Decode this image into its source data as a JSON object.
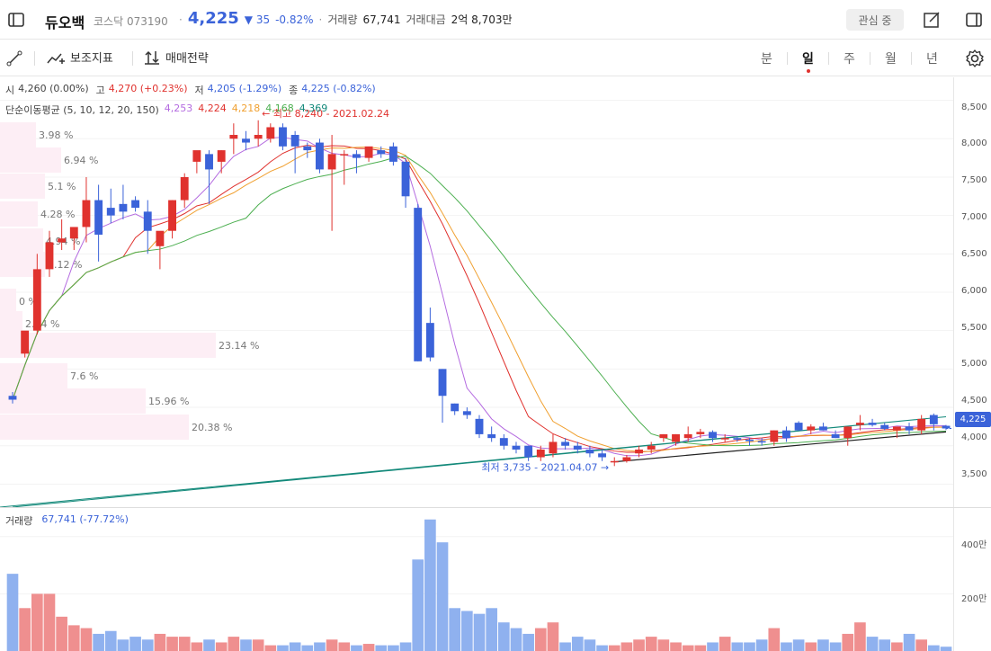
{
  "header": {
    "name": "듀오백",
    "market": "코스닥",
    "code": "073190",
    "price": "4,225",
    "change": "35",
    "change_pct": "-0.82%",
    "volume_label": "거래량",
    "volume": "67,741",
    "amount_label": "거래대금",
    "amount": "2억 8,703만",
    "watch_label": "관심 중"
  },
  "toolbar": {
    "indicator_label": "보조지표",
    "strategy_label": "매매전략",
    "periods": [
      "분",
      "일",
      "주",
      "월",
      "년"
    ],
    "active_period": "일"
  },
  "ohlc": {
    "open_label": "시",
    "open": "4,260 (0.00%)",
    "high_label": "고",
    "high": "4,270 (+0.23%)",
    "low_label": "저",
    "low": "4,205 (-1.29%)",
    "close_label": "종",
    "close": "4,225 (-0.82%)"
  },
  "ma": {
    "label": "단순이동평균 (5, 10, 12, 20, 150)",
    "values": [
      "4,253",
      "4,224",
      "4,218",
      "4,168",
      "4,369"
    ],
    "colors": [
      "#b46be0",
      "#e0322e",
      "#f0a030",
      "#4caf50",
      "#13897a"
    ]
  },
  "annotations": {
    "high": "최고 8,240 - 2021.02.24",
    "low": "최저 3,735 - 2021.04.07"
  },
  "volume_profile": [
    "3.98 %",
    "6.94 %",
    "5.1 %",
    "4.28 %",
    "4.94 %",
    "5.12 %",
    "0 %",
    "2.54 %",
    "23.14 %",
    "7.6 %",
    "15.96 %",
    "20.38 %"
  ],
  "y_axis": [
    "8,500",
    "8,000",
    "7,500",
    "7,000",
    "6,500",
    "6,000",
    "5,500",
    "5,000",
    "4,500",
    "4,000",
    "3,500"
  ],
  "current_price_tag": "4,225",
  "volume_panel": {
    "label": "거래량",
    "value": "67,741 (-77.72%)",
    "y_axis": [
      "400만",
      "200만"
    ]
  },
  "colors": {
    "up": "#e0322e",
    "down": "#3b63d9",
    "profile": "#fdeef5"
  },
  "chart_data": {
    "type": "candlestick",
    "ylim": [
      3200,
      8800
    ],
    "candles": [
      {
        "o": 4650,
        "h": 4700,
        "l": 4550,
        "c": 4600
      },
      {
        "o": 5200,
        "h": 5300,
        "l": 5150,
        "c": 5500
      },
      {
        "o": 5500,
        "h": 6500,
        "l": 5450,
        "c": 6300
      },
      {
        "o": 6300,
        "h": 6800,
        "l": 6200,
        "c": 6650
      },
      {
        "o": 6650,
        "h": 6950,
        "l": 6550,
        "c": 6700
      },
      {
        "o": 6700,
        "h": 6780,
        "l": 6550,
        "c": 6850
      },
      {
        "o": 6850,
        "h": 7500,
        "l": 6650,
        "c": 7200
      },
      {
        "o": 7200,
        "h": 7400,
        "l": 6400,
        "c": 6750
      },
      {
        "o": 7100,
        "h": 7350,
        "l": 6900,
        "c": 7000
      },
      {
        "o": 7150,
        "h": 7400,
        "l": 6950,
        "c": 7050
      },
      {
        "o": 7200,
        "h": 7250,
        "l": 7050,
        "c": 7100
      },
      {
        "o": 7050,
        "h": 7200,
        "l": 6500,
        "c": 6800
      },
      {
        "o": 6600,
        "h": 6700,
        "l": 6300,
        "c": 6800
      },
      {
        "o": 6800,
        "h": 7200,
        "l": 6700,
        "c": 7200
      },
      {
        "o": 7200,
        "h": 7550,
        "l": 7100,
        "c": 7500
      },
      {
        "o": 7700,
        "h": 7750,
        "l": 7550,
        "c": 7850
      },
      {
        "o": 7800,
        "h": 7850,
        "l": 7150,
        "c": 7600
      },
      {
        "o": 7700,
        "h": 7850,
        "l": 7550,
        "c": 7850
      },
      {
        "o": 8000,
        "h": 8200,
        "l": 7800,
        "c": 8050
      },
      {
        "o": 8000,
        "h": 8100,
        "l": 7850,
        "c": 7950
      },
      {
        "o": 8000,
        "h": 8240,
        "l": 7900,
        "c": 8050
      },
      {
        "o": 8000,
        "h": 8200,
        "l": 7950,
        "c": 8150
      },
      {
        "o": 8150,
        "h": 8200,
        "l": 7850,
        "c": 7900
      },
      {
        "o": 8050,
        "h": 8100,
        "l": 7550,
        "c": 7900
      },
      {
        "o": 7900,
        "h": 7950,
        "l": 7750,
        "c": 7850
      },
      {
        "o": 7950,
        "h": 8000,
        "l": 7550,
        "c": 7600
      },
      {
        "o": 7600,
        "h": 8050,
        "l": 6800,
        "c": 7800
      },
      {
        "o": 7800,
        "h": 7850,
        "l": 7400,
        "c": 7800
      },
      {
        "o": 7800,
        "h": 7850,
        "l": 7550,
        "c": 7750
      },
      {
        "o": 7750,
        "h": 7850,
        "l": 7700,
        "c": 7900
      },
      {
        "o": 7850,
        "h": 7900,
        "l": 7750,
        "c": 7800
      },
      {
        "o": 7900,
        "h": 7950,
        "l": 7650,
        "c": 7700
      },
      {
        "o": 7700,
        "h": 7750,
        "l": 7100,
        "c": 7250
      },
      {
        "o": 7100,
        "h": 7150,
        "l": 5100,
        "c": 5100
      },
      {
        "o": 5600,
        "h": 5800,
        "l": 5100,
        "c": 5150
      },
      {
        "o": 5000,
        "h": 5000,
        "l": 4300,
        "c": 4650
      },
      {
        "o": 4550,
        "h": 4550,
        "l": 4400,
        "c": 4450
      },
      {
        "o": 4450,
        "h": 4500,
        "l": 4350,
        "c": 4400
      },
      {
        "o": 4350,
        "h": 4400,
        "l": 4100,
        "c": 4150
      },
      {
        "o": 4150,
        "h": 4250,
        "l": 4050,
        "c": 4100
      },
      {
        "o": 4100,
        "h": 4150,
        "l": 3950,
        "c": 4000
      },
      {
        "o": 4000,
        "h": 4050,
        "l": 3900,
        "c": 3950
      },
      {
        "o": 4000,
        "h": 4000,
        "l": 3800,
        "c": 3850
      },
      {
        "o": 3850,
        "h": 4000,
        "l": 3800,
        "c": 3950
      },
      {
        "o": 3900,
        "h": 4150,
        "l": 3850,
        "c": 4050
      },
      {
        "o": 4050,
        "h": 4100,
        "l": 3950,
        "c": 4000
      },
      {
        "o": 4000,
        "h": 4050,
        "l": 3900,
        "c": 3950
      },
      {
        "o": 3950,
        "h": 4000,
        "l": 3850,
        "c": 3900
      },
      {
        "o": 3900,
        "h": 3950,
        "l": 3800,
        "c": 3850
      },
      {
        "o": 3800,
        "h": 3850,
        "l": 3735,
        "c": 3800
      },
      {
        "o": 3800,
        "h": 3880,
        "l": 3780,
        "c": 3850
      },
      {
        "o": 3900,
        "h": 4000,
        "l": 3850,
        "c": 3950
      },
      {
        "o": 3950,
        "h": 4050,
        "l": 3900,
        "c": 4000
      },
      {
        "o": 4100,
        "h": 4150,
        "l": 4050,
        "c": 4150
      },
      {
        "o": 4050,
        "h": 4150,
        "l": 4000,
        "c": 4150
      },
      {
        "o": 4100,
        "h": 4250,
        "l": 4050,
        "c": 4150
      },
      {
        "o": 4150,
        "h": 4220,
        "l": 4100,
        "c": 4180
      },
      {
        "o": 4180,
        "h": 4200,
        "l": 4050,
        "c": 4100
      },
      {
        "o": 4100,
        "h": 4150,
        "l": 4050,
        "c": 4100
      },
      {
        "o": 4100,
        "h": 4120,
        "l": 4050,
        "c": 4080
      },
      {
        "o": 4080,
        "h": 4100,
        "l": 4000,
        "c": 4060
      },
      {
        "o": 4060,
        "h": 4100,
        "l": 4000,
        "c": 4050
      },
      {
        "o": 4050,
        "h": 4200,
        "l": 4000,
        "c": 4200
      },
      {
        "o": 4200,
        "h": 4250,
        "l": 4050,
        "c": 4100
      },
      {
        "o": 4300,
        "h": 4320,
        "l": 4200,
        "c": 4200
      },
      {
        "o": 4200,
        "h": 4280,
        "l": 4150,
        "c": 4250
      },
      {
        "o": 4250,
        "h": 4300,
        "l": 4200,
        "c": 4200
      },
      {
        "o": 4150,
        "h": 4200,
        "l": 4100,
        "c": 4100
      },
      {
        "o": 4100,
        "h": 4250,
        "l": 4000,
        "c": 4250
      },
      {
        "o": 4270,
        "h": 4400,
        "l": 4200,
        "c": 4300
      },
      {
        "o": 4300,
        "h": 4350,
        "l": 4250,
        "c": 4270
      },
      {
        "o": 4270,
        "h": 4300,
        "l": 4200,
        "c": 4220
      },
      {
        "o": 4200,
        "h": 4250,
        "l": 4100,
        "c": 4250
      },
      {
        "o": 4250,
        "h": 4300,
        "l": 4150,
        "c": 4200
      },
      {
        "o": 4200,
        "h": 4400,
        "l": 4150,
        "c": 4350
      },
      {
        "o": 4400,
        "h": 4420,
        "l": 4200,
        "c": 4280
      },
      {
        "o": 4260,
        "h": 4270,
        "l": 4205,
        "c": 4225
      }
    ],
    "volumes": [
      270,
      150,
      200,
      200,
      120,
      90,
      80,
      60,
      70,
      40,
      50,
      40,
      60,
      50,
      50,
      30,
      40,
      30,
      50,
      40,
      40,
      20,
      20,
      30,
      20,
      30,
      40,
      30,
      20,
      25,
      20,
      20,
      30,
      320,
      460,
      380,
      150,
      140,
      130,
      150,
      100,
      80,
      60,
      80,
      100,
      30,
      50,
      40,
      20,
      20,
      30,
      40,
      50,
      40,
      30,
      20,
      20,
      30,
      50,
      30,
      30,
      40,
      80,
      30,
      40,
      30,
      40,
      30,
      60,
      100,
      50,
      40,
      30,
      60,
      40,
      20,
      15
    ]
  }
}
